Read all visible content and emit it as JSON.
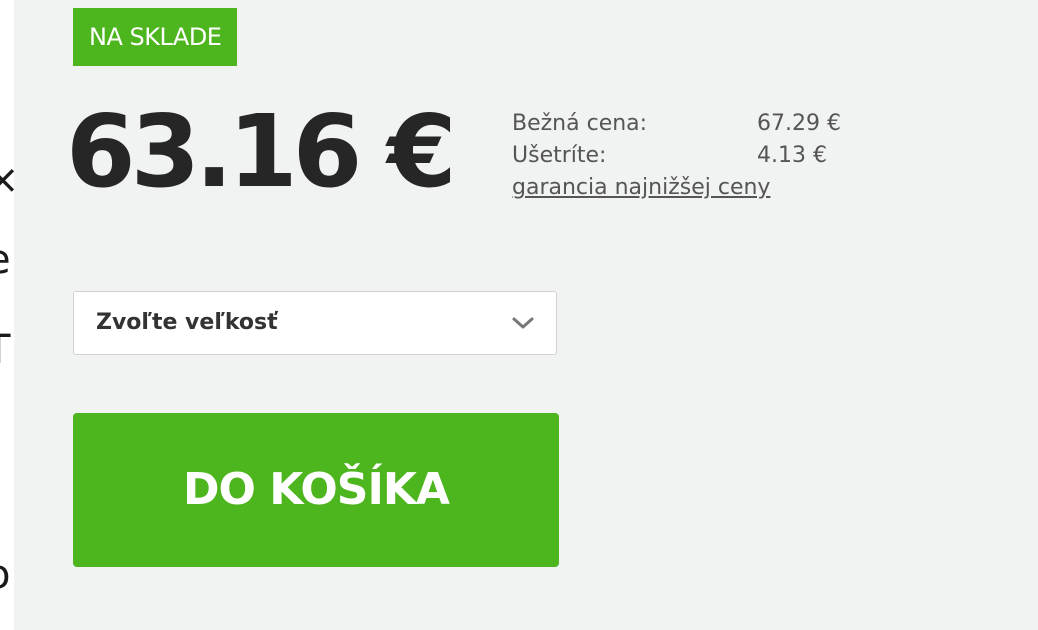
{
  "product": {
    "stock_badge": "NA SKLADE",
    "price": "63.16 €",
    "regular_price_label": "Bežná cena:",
    "regular_price_value": "67.29 €",
    "savings_label": "Ušetríte:",
    "savings_value": "4.13 €",
    "guarantee_link": "garancia najnižšej ceny"
  },
  "size_select": {
    "selected_label": "Zvoľte veľkosť",
    "icon": "chevron-down-icon"
  },
  "cart": {
    "button_label": "DO KOŠÍKA"
  },
  "colors": {
    "accent": "#4db51e",
    "panel_background": "#f1f2f2",
    "price_text": "#262626",
    "secondary_text": "#555555"
  }
}
